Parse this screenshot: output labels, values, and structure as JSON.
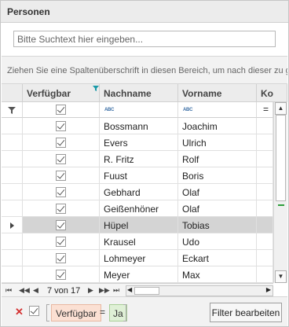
{
  "panel": {
    "title": "Personen"
  },
  "search": {
    "placeholder": "Bitte Suchtext hier eingeben..."
  },
  "grid": {
    "group_panel_text": "Ziehen Sie eine Spaltenüberschrift in diesen Bereich, um nach dieser zu gr",
    "columns": [
      "Verfügbar",
      "Nachname",
      "Vorname",
      "Ko"
    ],
    "filter_row": {
      "text_filter_icon": "abc",
      "operator_symbol": "="
    },
    "rows": [
      {
        "verfuegbar": true,
        "nachname": "Bossmann",
        "vorname": "Joachim",
        "selected": false
      },
      {
        "verfuegbar": true,
        "nachname": "Evers",
        "vorname": "Ulrich",
        "selected": false
      },
      {
        "verfuegbar": true,
        "nachname": "R. Fritz",
        "vorname": "Rolf",
        "selected": false
      },
      {
        "verfuegbar": true,
        "nachname": "Fuust",
        "vorname": "Boris",
        "selected": false
      },
      {
        "verfuegbar": true,
        "nachname": "Gebhard",
        "vorname": "Olaf",
        "selected": false
      },
      {
        "verfuegbar": true,
        "nachname": "Geißenhöner",
        "vorname": "Olaf",
        "selected": false
      },
      {
        "verfuegbar": true,
        "nachname": "Hüpel",
        "vorname": "Tobias",
        "selected": true
      },
      {
        "verfuegbar": true,
        "nachname": "Krausel",
        "vorname": "Udo",
        "selected": false
      },
      {
        "verfuegbar": true,
        "nachname": "Lohmeyer",
        "vorname": "Eckart",
        "selected": false
      },
      {
        "verfuegbar": true,
        "nachname": "Meyer",
        "vorname": "Max",
        "selected": false
      }
    ],
    "navigator": {
      "record_text": "7 von 17"
    }
  },
  "filter_bar": {
    "field": "Verfügbar",
    "operator": "=",
    "value": "Ja",
    "edit_button": "Filter bearbeiten"
  },
  "colors": {
    "selected_row": "#d4d4d4",
    "filter_field_bg": "#fbe0d3",
    "filter_value_bg": "#dff0d6",
    "accent": "#2e9e3c"
  }
}
